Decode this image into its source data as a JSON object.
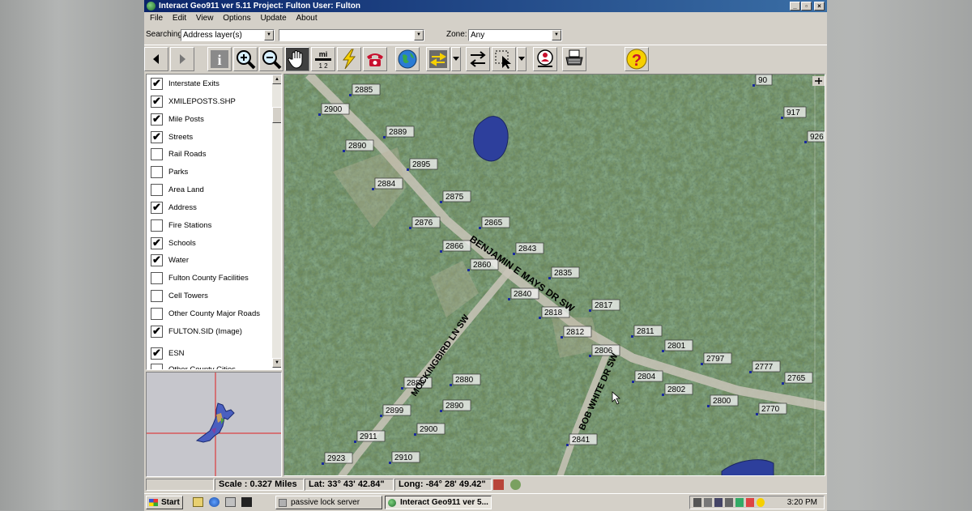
{
  "window": {
    "title": "Interact Geo911 ver 5.11   Project: Fulton User: Fulton"
  },
  "menu": [
    "File",
    "Edit",
    "View",
    "Options",
    "Update",
    "About"
  ],
  "search": {
    "label": "Searching:",
    "layer_value": "Address layer(s)",
    "query_value": "",
    "zone_label": "Zone:",
    "zone_value": "Any"
  },
  "toolbar": {
    "icons": [
      "back-arrow-icon",
      "forward-arrow-icon",
      "info-icon",
      "zoom-in-icon",
      "zoom-out-icon",
      "pan-hand-icon",
      "measure-icon",
      "lightning-icon",
      "phone-icon",
      "globe-icon",
      "route-icon",
      "swap-arrows-icon",
      "select-arrow-icon",
      "locate-person-icon",
      "print-icon",
      "help-icon"
    ],
    "measure_text": "mi",
    "measure_ratio": "1 2"
  },
  "layers": [
    {
      "name": "Interstate Exits",
      "checked": true
    },
    {
      "name": "XMILEPOSTS.SHP",
      "checked": true
    },
    {
      "name": "Mile Posts",
      "checked": true
    },
    {
      "name": "Streets",
      "checked": true
    },
    {
      "name": "Rail Roads",
      "checked": false
    },
    {
      "name": "Parks",
      "checked": false
    },
    {
      "name": "Area Land",
      "checked": false
    },
    {
      "name": "Address",
      "checked": true
    },
    {
      "name": "Fire Stations",
      "checked": false
    },
    {
      "name": "Schools",
      "checked": true
    },
    {
      "name": "Water",
      "checked": true
    },
    {
      "name": "Fulton County Facilities",
      "checked": false
    },
    {
      "name": "Cell Towers",
      "checked": false
    },
    {
      "name": "Other County Major Roads",
      "checked": false
    },
    {
      "name": "FULTON.SID (Image)",
      "checked": true
    },
    {
      "name": "ESN",
      "checked": true
    },
    {
      "name": "Other County Cities",
      "checked": false
    }
  ],
  "map": {
    "streets": [
      {
        "name": "BENJAMIN E MAYS DR SW"
      },
      {
        "name": "MOCKINGBIRD LN SW"
      },
      {
        "name": "BOB WHITE DR SW"
      }
    ],
    "addresses": [
      "2885",
      "2900",
      "2889",
      "2890",
      "2895",
      "2884",
      "2875",
      "2876",
      "2865",
      "2866",
      "2843",
      "2860",
      "2835",
      "2840",
      "2817",
      "2818",
      "2812",
      "2811",
      "2806",
      "2801",
      "2797",
      "2777",
      "2765",
      "2804",
      "2802",
      "2800",
      "2770",
      "2880",
      "2889",
      "2890",
      "2899",
      "2900",
      "2911",
      "2841",
      "2910",
      "2923",
      "917",
      "926",
      "90"
    ]
  },
  "status": {
    "scale": "Scale :  0.327 Miles",
    "lat": "Lat:  33° 43' 42.84\"",
    "long": "Long:  -84° 28' 49.42\""
  },
  "taskbar": {
    "start": "Start",
    "tasks": [
      "passive lock server",
      "Interact Geo911 ver 5..."
    ],
    "clock": "3:20 PM"
  },
  "colors": {
    "title_start": "#0a246a",
    "title_end": "#3a6ea5",
    "water": "#2d3f9c",
    "label_bg": "#f0f0f0",
    "crosshair": "#e02020"
  }
}
